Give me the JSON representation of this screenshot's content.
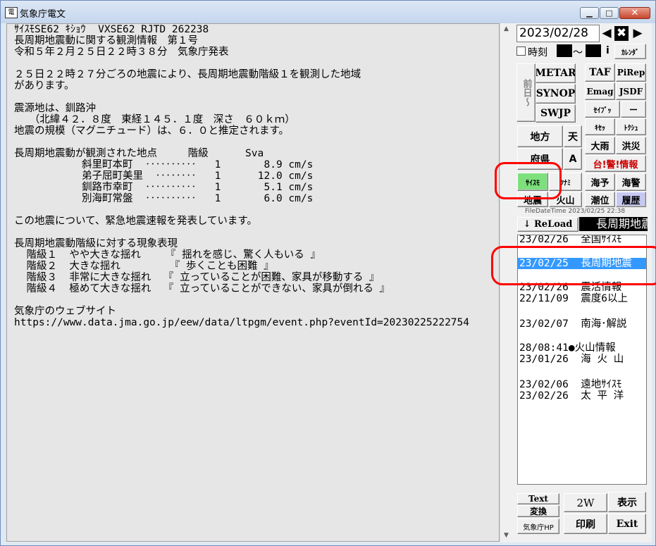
{
  "window": {
    "title": "気象庁電文",
    "app_icon_text": "電",
    "min_glyph": "▁",
    "max_glyph": "□",
    "close_glyph": "✕"
  },
  "message": {
    "lines": [
      "ｻｲｽﾓSE62 ｷｼｮｳ  VXSE62 RJTD 262238",
      "長周期地震動に関する観測情報　第１号",
      "令和５年２月２５日２２時３８分　気象庁発表",
      "",
      "２５日２２時２７分ごろの地震により、長周期地震動階級１を観測した地域",
      "があります。",
      "",
      "震源地は、釧路沖",
      "　　（北緯４２．８度　東経１４５．１度　深さ　６０ｋｍ）",
      "地震の規模（マグニチュード）は、６．０と推定されます。",
      "",
      "長周期地震動が観測された地点     階級      Sva",
      "           斜里町本町  ‥‥‥‥‥   1       8.9 cm/s",
      "           弟子屈町美里  ‥‥‥‥   1      12.0 cm/s",
      "           釧路市幸町  ‥‥‥‥‥   1       5.1 cm/s",
      "           別海町常盤  ‥‥‥‥‥   1       6.0 cm/s",
      "",
      "この地震について、緊急地震速報を発表しています。",
      "",
      "長周期地震動階級に対する現象表現",
      "  階級１  やや大きな揺れ    『 揺れを感じ、驚く人もいる 』",
      "  階級２  大きな揺れ        『 歩くことも困難 』",
      "  階級３  非常に大きな揺れ  『 立っていることが困難、家具が移動する 』",
      "  階級４  極めて大きな揺れ  『 立っていることができない、家具が倒れる 』",
      "",
      "気象庁のウェブサイト",
      "https://www.data.jma.go.jp/eew/data/ltpgm/event.php?eventId=20230225222754"
    ]
  },
  "scrollbar": {
    "up": "▲",
    "down": "▼"
  },
  "date_nav": {
    "date_value": "2023/02/28",
    "prev": "◀",
    "mid": "✖",
    "next": "▶",
    "time_label": "時刻",
    "tilde": "〜",
    "i_label": "i",
    "calendar": "ｶﾚﾝﾀﾞ"
  },
  "buttons": {
    "zenjitsu": "前日〜",
    "metar": "METAR",
    "synop": "SYNOP",
    "swjp": "SWJP",
    "taf": "TAF",
    "pirep": "PiRep",
    "emag": "Emag",
    "jsdf": "JSDF",
    "seibu": "ｾｲﾌﾞｯ",
    "dash": "ー",
    "kiset": "ｷｾｯ",
    "tokushu": "ﾄｸｼｭ",
    "chihou": "地方",
    "ten": "天",
    "fuken": "府県",
    "a": "A",
    "ooame": "大雨",
    "kozui": "洪災",
    "taikei": "台!警!情報",
    "saismo": "ｻｲｽﾓ",
    "tsunami": "ﾂﾅﾐ",
    "kaiyo": "海予",
    "kaikei": "海警",
    "jishin": "地震",
    "kazan": "火山",
    "choi": "潮位",
    "rireki": "履歴",
    "reload": "↓ ReLoad",
    "text_henkan_1": "Text",
    "text_henkan_2": "変換",
    "jma_hp": "気象庁HP",
    "two_w": "2W",
    "hyouji": "表示",
    "insatsu": "印刷",
    "exit": "Exit"
  },
  "file_date": "FileDateTime   2023/02/25 22:38",
  "marquee_text": "長周期地震",
  "list_items": [
    "23/02/26  全国ｻｲｽﾓ",
    "23/02/25  長周期地震",
    "23/02/26  震活情報",
    "22/11/09  震度6以上",
    "23/02/07  南海･解説",
    "28/08:41●火山情報",
    "23/01/26  海 火 山",
    "23/02/06  遠地ｻｲｽﾓ",
    "23/02/26  太 平 洋"
  ],
  "colors": {
    "selection": "#3399ff",
    "highlight_ring": "#ff0000",
    "saismo_green": "#7de07d",
    "rireki_blue": "#c6c8f4",
    "taikei_red": "#cc0000"
  }
}
